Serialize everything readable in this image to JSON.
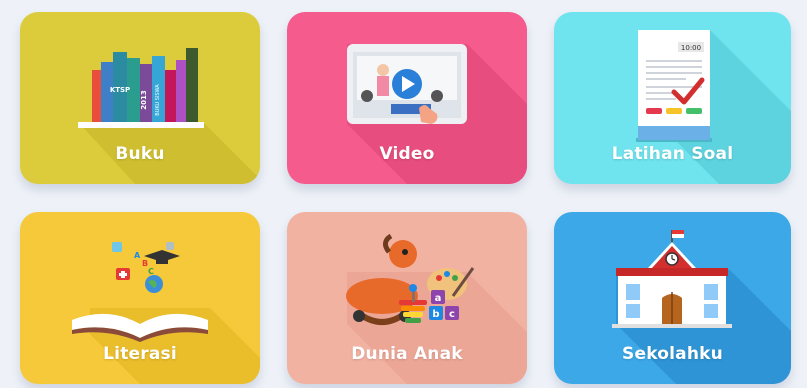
{
  "tiles": [
    {
      "label": "Buku",
      "color": "#dccc3b",
      "icon": "books-icon"
    },
    {
      "label": "Video",
      "color": "#f65b8d",
      "icon": "video-play-icon"
    },
    {
      "label": "Latihan Soal",
      "color": "#6fe3ee",
      "icon": "exam-sheet-icon"
    },
    {
      "label": "Literasi",
      "color": "#f5c93a",
      "icon": "open-book-icon"
    },
    {
      "label": "Dunia Anak",
      "color": "#f2b2a2",
      "icon": "toys-icon"
    },
    {
      "label": "Sekolahku",
      "color": "#3ca8e8",
      "icon": "school-building-icon"
    }
  ],
  "book_spines": [
    "KTSP",
    "2013",
    "BUKU SISWA"
  ],
  "exam_clock": "10:00",
  "blocks": [
    "a",
    "b",
    "c"
  ],
  "literacy_letters": [
    "A",
    "B",
    "C"
  ]
}
